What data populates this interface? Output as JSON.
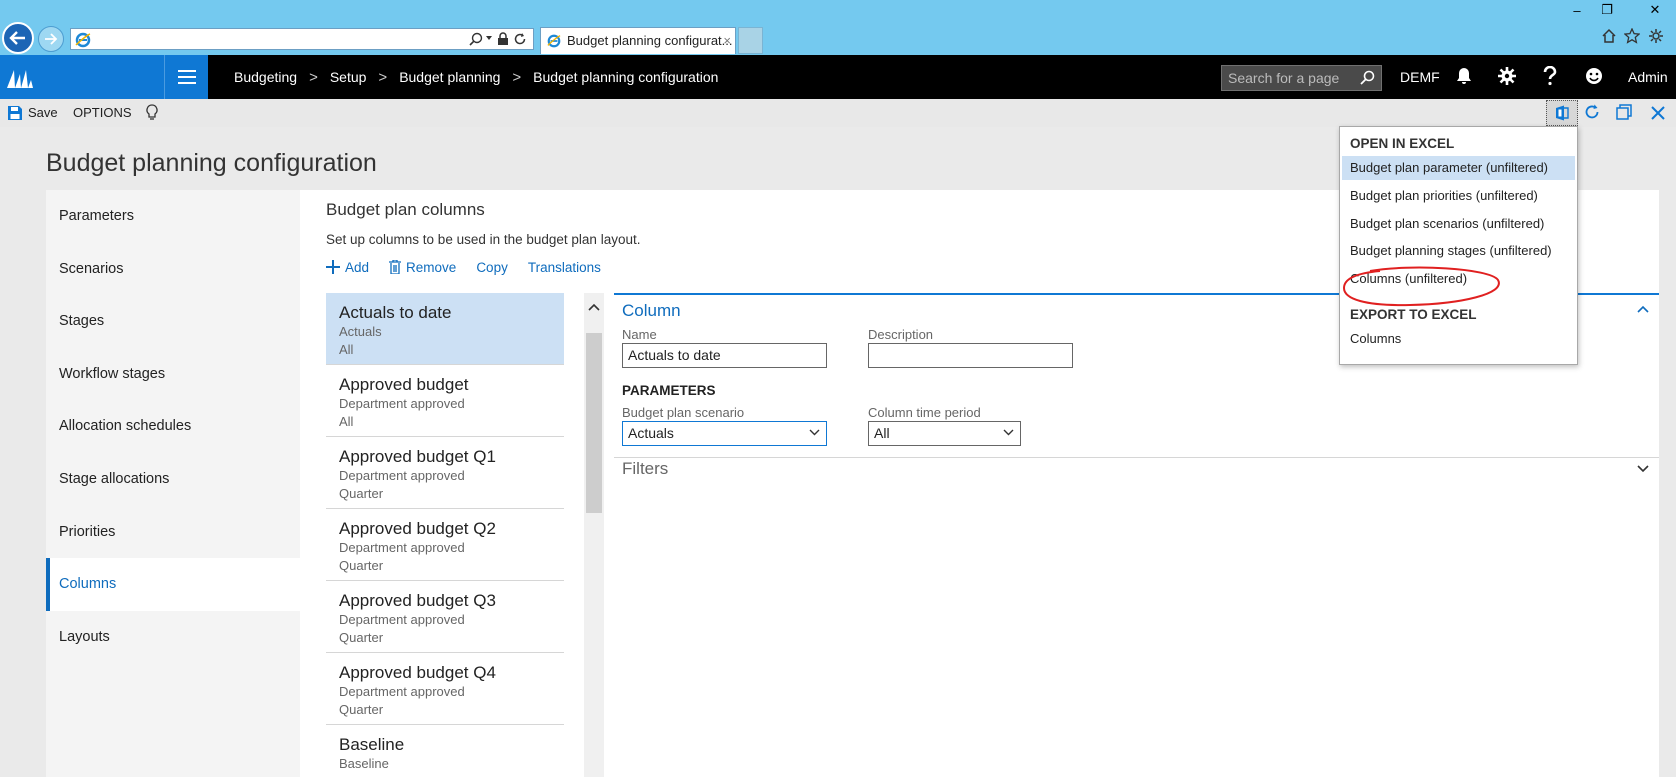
{
  "browser": {
    "address": "",
    "tab_title": "Budget planning configurat...",
    "tab_close": "×",
    "window_controls": [
      "‒",
      "❐",
      "✕"
    ]
  },
  "header": {
    "breadcrumbs": [
      "Budgeting",
      "Setup",
      "Budget planning",
      "Budget planning configuration"
    ],
    "breadcrumb_sep": ">",
    "search_placeholder": "Search for a page",
    "company": "DEMF",
    "user": "Admin"
  },
  "action_pane": {
    "save_label": "Save",
    "options_label": "OPTIONS"
  },
  "page": {
    "title": "Budget planning configuration"
  },
  "left_nav": {
    "items": [
      {
        "label": "Parameters"
      },
      {
        "label": "Scenarios"
      },
      {
        "label": "Stages"
      },
      {
        "label": "Workflow stages"
      },
      {
        "label": "Allocation schedules"
      },
      {
        "label": "Stage allocations"
      },
      {
        "label": "Priorities"
      },
      {
        "label": "Columns",
        "selected": true
      },
      {
        "label": "Layouts"
      }
    ]
  },
  "panel": {
    "title": "Budget plan columns",
    "description": "Set up columns to be used in the budget plan layout.",
    "toolbar": {
      "add": "Add",
      "remove": "Remove",
      "copy": "Copy",
      "translations": "Translations"
    },
    "list": [
      {
        "title": "Actuals to date",
        "line1": "Actuals",
        "line2": "All",
        "selected": true
      },
      {
        "title": "Approved budget",
        "line1": "Department approved",
        "line2": "All"
      },
      {
        "title": "Approved budget Q1",
        "line1": "Department approved",
        "line2": "Quarter"
      },
      {
        "title": "Approved budget Q2",
        "line1": "Department approved",
        "line2": "Quarter"
      },
      {
        "title": "Approved budget Q3",
        "line1": "Department approved",
        "line2": "Quarter"
      },
      {
        "title": "Approved budget Q4",
        "line1": "Department approved",
        "line2": "Quarter"
      },
      {
        "title": "Baseline",
        "line1": "Baseline",
        "line2": ""
      }
    ]
  },
  "detail": {
    "column_section": "Column",
    "name_label": "Name",
    "name_value": "Actuals to date",
    "description_label": "Description",
    "description_value": "",
    "parameters_label": "PARAMETERS",
    "scenario_label": "Budget plan scenario",
    "scenario_value": "Actuals",
    "period_label": "Column time period",
    "period_value": "All",
    "filters_section": "Filters"
  },
  "excel_menu": {
    "open_header": "OPEN IN EXCEL",
    "open_items": [
      "Budget plan parameter (unfiltered)",
      "Budget plan priorities (unfiltered)",
      "Budget plan scenarios (unfiltered)",
      "Budget planning stages (unfiltered)",
      "Columns (unfiltered)"
    ],
    "export_header": "EXPORT TO EXCEL",
    "export_items": [
      "Columns"
    ]
  },
  "colors": {
    "accent": "#0f78d4",
    "ie_bar": "#74c9ef",
    "header_bg": "#000000",
    "selection": "#cce0f4",
    "annotation": "#e02020"
  }
}
